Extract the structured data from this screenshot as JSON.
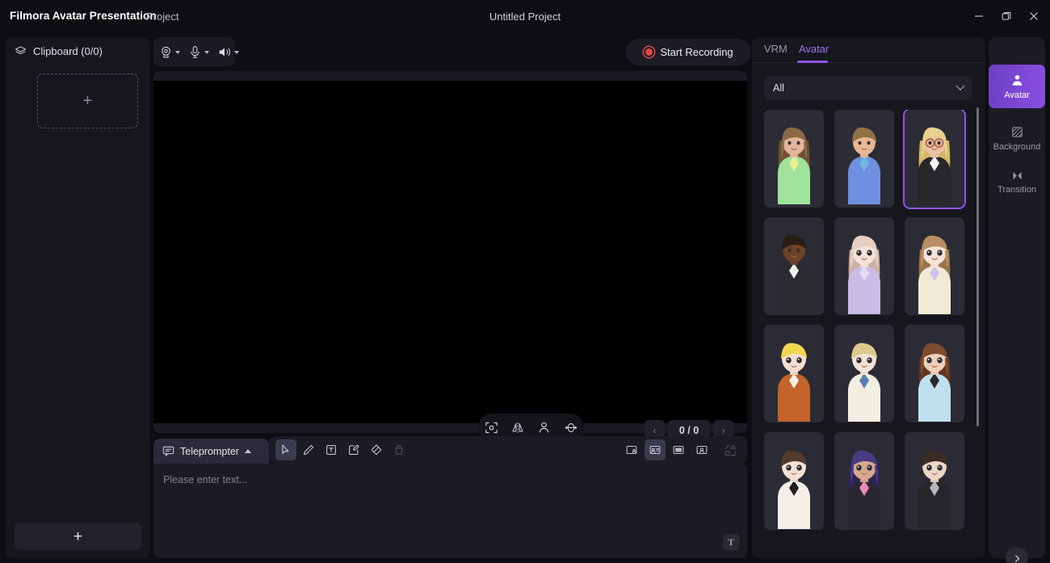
{
  "titlebar": {
    "app_name": "Filmora Avatar Presentation",
    "menu_project": "Project",
    "window_title": "Untitled Project",
    "minimize": "minimize-icon",
    "maximize": "restore-icon",
    "close": "close-icon"
  },
  "left_panel": {
    "clipboard_label": "Clipboard (0/0)",
    "clipboard_icon": "layers-icon",
    "dropzone_plus": "+",
    "add_button_plus": "+"
  },
  "device_bar": {
    "camera_icon": "camera-icon",
    "mic_icon": "microphone-icon",
    "speaker_icon": "speaker-icon"
  },
  "record": {
    "label": "Start Recording",
    "dot_color": "#e0473f"
  },
  "stage": {
    "view_tools": [
      {
        "name": "fit-to-frame-icon"
      },
      {
        "name": "mirror-flip-icon"
      },
      {
        "name": "portrait-person-icon"
      },
      {
        "name": "rotate-3d-icon"
      }
    ],
    "pager": {
      "prev": "‹",
      "count": "0 / 0",
      "next": "›"
    }
  },
  "teleprompter": {
    "tab_label": "Teleprompter",
    "tab_icon": "comment-icon",
    "caret": "caret-up-icon",
    "placeholder": "Please enter text...",
    "text_format_button": "T",
    "tools_left": [
      {
        "name": "select-cursor-icon",
        "active": true
      },
      {
        "name": "pen-icon",
        "active": false
      },
      {
        "name": "text-box-icon",
        "active": false
      },
      {
        "name": "note-edit-icon",
        "active": false
      },
      {
        "name": "eraser-icon",
        "active": false
      },
      {
        "name": "clear-all-icon",
        "active": false,
        "disabled": true
      }
    ],
    "tools_right": [
      {
        "name": "layout-small-avatar-icon",
        "active": false
      },
      {
        "name": "layout-avatar-left-icon",
        "active": true
      },
      {
        "name": "layout-screen-only-icon",
        "active": false
      },
      {
        "name": "layout-avatar-only-icon",
        "active": false
      },
      {
        "name": "layout-customize-icon",
        "active": false,
        "disabled": true
      }
    ]
  },
  "right_panel": {
    "tabs": [
      {
        "label": "VRM",
        "active": false
      },
      {
        "label": "Avatar",
        "active": true
      }
    ],
    "filter": {
      "value": "All",
      "chevron": "chevron-down-icon"
    },
    "accent_color": "#9155ef",
    "avatars": [
      {
        "id": 1,
        "name": "3d-woman-green-top",
        "selected": false
      },
      {
        "id": 2,
        "name": "3d-man-blue-shirt",
        "selected": false
      },
      {
        "id": 3,
        "name": "3d-woman-glasses-suit",
        "selected": true
      },
      {
        "id": 4,
        "name": "3d-man-dark-suit",
        "selected": false
      },
      {
        "id": 5,
        "name": "anime-girl-lilac-dress",
        "selected": false
      },
      {
        "id": 6,
        "name": "anime-girl-cream-cardigan",
        "selected": false
      },
      {
        "id": 7,
        "name": "anime-boy-orange-jacket",
        "selected": false
      },
      {
        "id": 8,
        "name": "anime-boy-blue-tie",
        "selected": false
      },
      {
        "id": 9,
        "name": "anime-girl-lightblue-dress",
        "selected": false
      },
      {
        "id": 10,
        "name": "anime-girl-white-cardigan",
        "selected": false
      },
      {
        "id": 11,
        "name": "anime-girl-purple-punk",
        "selected": false
      },
      {
        "id": 12,
        "name": "anime-boy-grey-hoodie",
        "selected": false
      }
    ]
  },
  "rail": {
    "items": [
      {
        "label": "Avatar",
        "icon": "person-icon",
        "active": true
      },
      {
        "label": "Background",
        "icon": "hatch-square-icon",
        "active": false
      },
      {
        "label": "Transition",
        "icon": "transition-icon",
        "active": false
      }
    ],
    "collapse": "chevron-right-icon"
  }
}
